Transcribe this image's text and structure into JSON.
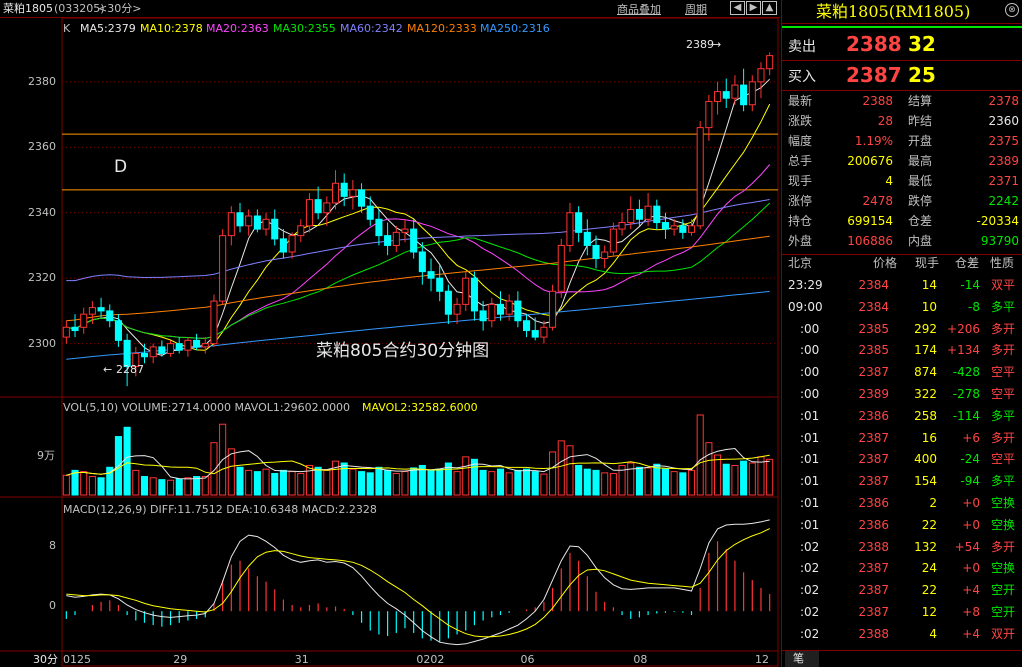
{
  "header": {
    "symbol": "菜粕1805",
    "code": "(033205)",
    "period": "<30分>",
    "overlay_btn": "商品叠加",
    "cycle_btn": "周期"
  },
  "ma_legend": {
    "k": "K",
    "items": [
      {
        "label": "MA5:2379",
        "color": "#e8e8e8"
      },
      {
        "label": "MA10:2378",
        "color": "#ffff00"
      },
      {
        "label": "MA20:2363",
        "color": "#ff44ff"
      },
      {
        "label": "MA30:2355",
        "color": "#00e600"
      },
      {
        "label": "MA60:2342",
        "color": "#8080ff"
      },
      {
        "label": "MA120:2333",
        "color": "#ff8000"
      },
      {
        "label": "MA250:2316",
        "color": "#3399ff"
      }
    ]
  },
  "price_axis": {
    "labels": [
      "2380",
      "2360",
      "2340",
      "2320",
      "2300"
    ],
    "values": [
      2380,
      2360,
      2340,
      2320,
      2300
    ]
  },
  "annotations": {
    "d_label": "D",
    "high_mark": "2389",
    "low_mark": "2287",
    "caption": "菜粕805合约30分钟图"
  },
  "volume": {
    "legend": "VOL(5,10) VOLUME:2714.0000 MAVOL1:29602.0000",
    "mavol2": "MAVOL2:32582.6000",
    "axis_label": "9万"
  },
  "macd": {
    "legend": "MACD(12,26,9) DIFF:11.7512 DEA:10.6348 MACD:2.2328",
    "axis_labels": [
      "8",
      "0"
    ]
  },
  "time_axis": {
    "period": "30分",
    "labels": [
      "0125",
      "29",
      "31",
      "0202",
      "06",
      "08",
      "12"
    ]
  },
  "quote": {
    "title": "菜粕1805(RM1805)",
    "sell_label": "卖出",
    "sell_price": "2388",
    "sell_vol": "32",
    "buy_label": "买入",
    "buy_price": "2387",
    "buy_vol": "25",
    "stats": [
      {
        "l1": "最新",
        "v1": "2388",
        "c1": "red",
        "l2": "结算",
        "v2": "2378",
        "c2": "red"
      },
      {
        "l1": "涨跌",
        "v1": "28",
        "c1": "red",
        "l2": "昨结",
        "v2": "2360",
        "c2": "wht"
      },
      {
        "l1": "幅度",
        "v1": "1.19%",
        "c1": "red",
        "l2": "开盘",
        "v2": "2375",
        "c2": "red"
      },
      {
        "l1": "总手",
        "v1": "200676",
        "c1": "yel",
        "l2": "最高",
        "v2": "2389",
        "c2": "red"
      },
      {
        "l1": "现手",
        "v1": "4",
        "c1": "yel",
        "l2": "最低",
        "v2": "2371",
        "c2": "red"
      },
      {
        "l1": "涨停",
        "v1": "2478",
        "c1": "red",
        "l2": "跌停",
        "v2": "2242",
        "c2": "grn"
      },
      {
        "l1": "持仓",
        "v1": "699154",
        "c1": "yel",
        "l2": "仓差",
        "v2": "-20334",
        "c2": "yel"
      },
      {
        "l1": "外盘",
        "v1": "106886",
        "c1": "red",
        "l2": "内盘",
        "v2": "93790",
        "c2": "grn"
      }
    ],
    "ticks_header": [
      "北京",
      "价格",
      "现手",
      "仓差",
      "性质"
    ],
    "ticks": [
      {
        "time": "23:29",
        "price": "2384",
        "vol": "14",
        "diff": "-14",
        "type": "双平",
        "tc": "red"
      },
      {
        "time": "09:00",
        "price": "2384",
        "vol": "10",
        "diff": "-8",
        "type": "多平",
        "tc": "grn"
      },
      {
        "time": ":00",
        "price": "2385",
        "vol": "292",
        "diff": "+206",
        "type": "多开",
        "tc": "red"
      },
      {
        "time": ":00",
        "price": "2385",
        "vol": "174",
        "diff": "+134",
        "type": "多开",
        "tc": "red"
      },
      {
        "time": ":00",
        "price": "2387",
        "vol": "874",
        "diff": "-428",
        "type": "空平",
        "tc": "red"
      },
      {
        "time": ":00",
        "price": "2389",
        "vol": "322",
        "diff": "-278",
        "type": "空平",
        "tc": "red"
      },
      {
        "time": ":01",
        "price": "2386",
        "vol": "258",
        "diff": "-114",
        "type": "多平",
        "tc": "grn"
      },
      {
        "time": ":01",
        "price": "2387",
        "vol": "16",
        "diff": "+6",
        "type": "多开",
        "tc": "red"
      },
      {
        "time": ":01",
        "price": "2387",
        "vol": "400",
        "diff": "-24",
        "type": "空平",
        "tc": "red"
      },
      {
        "time": ":01",
        "price": "2387",
        "vol": "154",
        "diff": "-94",
        "type": "多平",
        "tc": "grn"
      },
      {
        "time": ":01",
        "price": "2386",
        "vol": "2",
        "diff": "+0",
        "type": "空换",
        "tc": "grn"
      },
      {
        "time": ":01",
        "price": "2386",
        "vol": "22",
        "diff": "+0",
        "type": "空换",
        "tc": "grn"
      },
      {
        "time": ":02",
        "price": "2388",
        "vol": "132",
        "diff": "+54",
        "type": "多开",
        "tc": "red"
      },
      {
        "time": ":02",
        "price": "2387",
        "vol": "24",
        "diff": "+0",
        "type": "空换",
        "tc": "grn"
      },
      {
        "time": ":02",
        "price": "2387",
        "vol": "22",
        "diff": "+4",
        "type": "空开",
        "tc": "grn"
      },
      {
        "time": ":02",
        "price": "2387",
        "vol": "12",
        "diff": "+8",
        "type": "空开",
        "tc": "grn"
      },
      {
        "time": ":02",
        "price": "2388",
        "vol": "4",
        "diff": "+4",
        "type": "双开",
        "tc": "red"
      }
    ],
    "bottom_tab": "笔"
  },
  "chart_data": {
    "type": "candlestick",
    "title": "菜粕805合约30分钟图",
    "ylim": [
      2284,
      2394
    ],
    "x_labels": [
      "0125",
      "29",
      "31",
      "0202",
      "06",
      "08",
      "12"
    ],
    "candles": [
      {
        "o": 2302,
        "h": 2307,
        "l": 2300,
        "c": 2305
      },
      {
        "o": 2305,
        "h": 2309,
        "l": 2302,
        "c": 2304
      },
      {
        "o": 2305,
        "h": 2311,
        "l": 2303,
        "c": 2309
      },
      {
        "o": 2309,
        "h": 2313,
        "l": 2306,
        "c": 2311
      },
      {
        "o": 2311,
        "h": 2314,
        "l": 2308,
        "c": 2310
      },
      {
        "o": 2310,
        "h": 2312,
        "l": 2305,
        "c": 2307
      },
      {
        "o": 2307,
        "h": 2309,
        "l": 2299,
        "c": 2301
      },
      {
        "o": 2301,
        "h": 2303,
        "l": 2287,
        "c": 2293
      },
      {
        "o": 2293,
        "h": 2299,
        "l": 2290,
        "c": 2297
      },
      {
        "o": 2297,
        "h": 2300,
        "l": 2294,
        "c": 2296
      },
      {
        "o": 2296,
        "h": 2300,
        "l": 2294,
        "c": 2299
      },
      {
        "o": 2299,
        "h": 2301,
        "l": 2296,
        "c": 2297
      },
      {
        "o": 2297,
        "h": 2301,
        "l": 2296,
        "c": 2300
      },
      {
        "o": 2300,
        "h": 2302,
        "l": 2297,
        "c": 2298
      },
      {
        "o": 2298,
        "h": 2302,
        "l": 2296,
        "c": 2301
      },
      {
        "o": 2301,
        "h": 2303,
        "l": 2298,
        "c": 2299
      },
      {
        "o": 2299,
        "h": 2302,
        "l": 2297,
        "c": 2300
      },
      {
        "o": 2300,
        "h": 2315,
        "l": 2299,
        "c": 2313
      },
      {
        "o": 2313,
        "h": 2335,
        "l": 2312,
        "c": 2333
      },
      {
        "o": 2333,
        "h": 2342,
        "l": 2330,
        "c": 2340
      },
      {
        "o": 2340,
        "h": 2343,
        "l": 2334,
        "c": 2336
      },
      {
        "o": 2336,
        "h": 2341,
        "l": 2333,
        "c": 2339
      },
      {
        "o": 2339,
        "h": 2341,
        "l": 2334,
        "c": 2335
      },
      {
        "o": 2335,
        "h": 2340,
        "l": 2333,
        "c": 2338
      },
      {
        "o": 2338,
        "h": 2341,
        "l": 2330,
        "c": 2332
      },
      {
        "o": 2332,
        "h": 2335,
        "l": 2326,
        "c": 2328
      },
      {
        "o": 2328,
        "h": 2334,
        "l": 2326,
        "c": 2333
      },
      {
        "o": 2333,
        "h": 2338,
        "l": 2331,
        "c": 2336
      },
      {
        "o": 2336,
        "h": 2346,
        "l": 2334,
        "c": 2344
      },
      {
        "o": 2344,
        "h": 2348,
        "l": 2338,
        "c": 2340
      },
      {
        "o": 2340,
        "h": 2345,
        "l": 2336,
        "c": 2343
      },
      {
        "o": 2343,
        "h": 2353,
        "l": 2341,
        "c": 2349
      },
      {
        "o": 2349,
        "h": 2352,
        "l": 2342,
        "c": 2345
      },
      {
        "o": 2345,
        "h": 2350,
        "l": 2341,
        "c": 2347
      },
      {
        "o": 2347,
        "h": 2349,
        "l": 2340,
        "c": 2342
      },
      {
        "o": 2342,
        "h": 2345,
        "l": 2336,
        "c": 2338
      },
      {
        "o": 2338,
        "h": 2341,
        "l": 2330,
        "c": 2333
      },
      {
        "o": 2333,
        "h": 2337,
        "l": 2327,
        "c": 2330
      },
      {
        "o": 2330,
        "h": 2336,
        "l": 2328,
        "c": 2334
      },
      {
        "o": 2334,
        "h": 2338,
        "l": 2331,
        "c": 2335
      },
      {
        "o": 2335,
        "h": 2338,
        "l": 2326,
        "c": 2328
      },
      {
        "o": 2328,
        "h": 2331,
        "l": 2318,
        "c": 2322
      },
      {
        "o": 2322,
        "h": 2326,
        "l": 2316,
        "c": 2320
      },
      {
        "o": 2320,
        "h": 2324,
        "l": 2313,
        "c": 2316
      },
      {
        "o": 2316,
        "h": 2318,
        "l": 2306,
        "c": 2309
      },
      {
        "o": 2309,
        "h": 2314,
        "l": 2306,
        "c": 2312
      },
      {
        "o": 2312,
        "h": 2322,
        "l": 2310,
        "c": 2320
      },
      {
        "o": 2320,
        "h": 2322,
        "l": 2307,
        "c": 2310
      },
      {
        "o": 2310,
        "h": 2313,
        "l": 2304,
        "c": 2307
      },
      {
        "o": 2307,
        "h": 2314,
        "l": 2305,
        "c": 2312
      },
      {
        "o": 2312,
        "h": 2316,
        "l": 2307,
        "c": 2309
      },
      {
        "o": 2309,
        "h": 2315,
        "l": 2307,
        "c": 2313
      },
      {
        "o": 2313,
        "h": 2316,
        "l": 2305,
        "c": 2307
      },
      {
        "o": 2307,
        "h": 2309,
        "l": 2302,
        "c": 2304
      },
      {
        "o": 2304,
        "h": 2308,
        "l": 2301,
        "c": 2302
      },
      {
        "o": 2302,
        "h": 2307,
        "l": 2300,
        "c": 2305
      },
      {
        "o": 2305,
        "h": 2318,
        "l": 2304,
        "c": 2316
      },
      {
        "o": 2316,
        "h": 2332,
        "l": 2314,
        "c": 2330
      },
      {
        "o": 2330,
        "h": 2343,
        "l": 2328,
        "c": 2340
      },
      {
        "o": 2340,
        "h": 2342,
        "l": 2331,
        "c": 2334
      },
      {
        "o": 2334,
        "h": 2338,
        "l": 2327,
        "c": 2330
      },
      {
        "o": 2330,
        "h": 2333,
        "l": 2323,
        "c": 2326
      },
      {
        "o": 2326,
        "h": 2330,
        "l": 2323,
        "c": 2328
      },
      {
        "o": 2328,
        "h": 2337,
        "l": 2327,
        "c": 2335
      },
      {
        "o": 2335,
        "h": 2340,
        "l": 2333,
        "c": 2337
      },
      {
        "o": 2337,
        "h": 2345,
        "l": 2335,
        "c": 2341
      },
      {
        "o": 2341,
        "h": 2344,
        "l": 2336,
        "c": 2338
      },
      {
        "o": 2338,
        "h": 2346,
        "l": 2336,
        "c": 2342
      },
      {
        "o": 2342,
        "h": 2344,
        "l": 2335,
        "c": 2337
      },
      {
        "o": 2337,
        "h": 2340,
        "l": 2332,
        "c": 2335
      },
      {
        "o": 2335,
        "h": 2338,
        "l": 2333,
        "c": 2336
      },
      {
        "o": 2336,
        "h": 2338,
        "l": 2332,
        "c": 2334
      },
      {
        "o": 2334,
        "h": 2338,
        "l": 2333,
        "c": 2336
      },
      {
        "o": 2336,
        "h": 2368,
        "l": 2335,
        "c": 2366
      },
      {
        "o": 2366,
        "h": 2376,
        "l": 2362,
        "c": 2374
      },
      {
        "o": 2374,
        "h": 2380,
        "l": 2370,
        "c": 2377
      },
      {
        "o": 2377,
        "h": 2381,
        "l": 2372,
        "c": 2375
      },
      {
        "o": 2375,
        "h": 2382,
        "l": 2373,
        "c": 2379
      },
      {
        "o": 2379,
        "h": 2384,
        "l": 2371,
        "c": 2373
      },
      {
        "o": 2373,
        "h": 2382,
        "l": 2371,
        "c": 2380
      },
      {
        "o": 2380,
        "h": 2386,
        "l": 2375,
        "c": 2384
      },
      {
        "o": 2384,
        "h": 2389,
        "l": 2382,
        "c": 2388
      }
    ],
    "volume_scale_max": 130000,
    "volumes": [
      32,
      40,
      38,
      30,
      28,
      45,
      95,
      110,
      40,
      30,
      28,
      25,
      24,
      26,
      28,
      30,
      30,
      85,
      115,
      75,
      45,
      40,
      38,
      42,
      35,
      40,
      38,
      35,
      48,
      45,
      40,
      55,
      52,
      42,
      38,
      36,
      45,
      40,
      35,
      38,
      44,
      48,
      40,
      42,
      52,
      38,
      62,
      58,
      40,
      38,
      42,
      36,
      40,
      42,
      38,
      34,
      70,
      88,
      80,
      48,
      42,
      40,
      36,
      35,
      48,
      52,
      45,
      44,
      50,
      42,
      38,
      36,
      40,
      130,
      85,
      65,
      50,
      48,
      55,
      52,
      62,
      58
    ],
    "macd_range": [
      -5,
      12
    ],
    "macd_hist": [
      -1,
      -0.5,
      0,
      0.8,
      1.2,
      1.4,
      0.8,
      -0.5,
      -1.2,
      -1.5,
      -1.8,
      -2,
      -1.8,
      -1.5,
      -1.2,
      -1,
      -0.8,
      1,
      4,
      6,
      6.5,
      5.5,
      4.5,
      3.8,
      2.8,
      1.5,
      0.8,
      0.5,
      0.8,
      1,
      0.5,
      0.6,
      0.3,
      -0.5,
      -1.5,
      -2.5,
      -3,
      -3.2,
      -2.8,
      -2.2,
      -2.8,
      -3.5,
      -3.8,
      -4,
      -3.5,
      -3,
      -2.5,
      -1.8,
      -1.2,
      -0.8,
      -0.5,
      -0.2,
      0,
      0.2,
      0.5,
      1.2,
      3,
      5.5,
      7.5,
      6.5,
      4.5,
      2.5,
      1.2,
      0.5,
      -0.5,
      -1,
      -0.8,
      -0.5,
      -0.3,
      -0.2,
      -0.1,
      -0.2,
      -0.5,
      3,
      7.5,
      9,
      8,
      6.5,
      5,
      4,
      3,
      2.2
    ],
    "diff": [
      2,
      1.8,
      1.9,
      2.1,
      2.2,
      2.1,
      1.6,
      0.8,
      0.2,
      -0.2,
      -0.5,
      -0.7,
      -0.8,
      -0.7,
      -0.6,
      -0.5,
      -0.3,
      1,
      3.8,
      7,
      9,
      9.8,
      9.6,
      9,
      8.2,
      7.2,
      6.6,
      6.3,
      6.5,
      6.6,
      6.3,
      6.4,
      6.2,
      5.6,
      4.5,
      3.2,
      2,
      1,
      0.3,
      -0.5,
      -1.5,
      -2.5,
      -3.3,
      -4,
      -4.2,
      -4.3,
      -4.2,
      -3.9,
      -3.6,
      -3.2,
      -2.8,
      -2.3,
      -1.8,
      -1,
      0,
      1.5,
      4,
      6.5,
      8.4,
      8.3,
      7.2,
      5.6,
      4.3,
      3.4,
      2.9,
      2.8,
      2.9,
      3,
      3,
      3,
      3,
      2.8,
      2.6,
      5.5,
      8.8,
      10.6,
      11.1,
      11.2,
      11.2,
      11.3,
      11.5,
      11.75
    ],
    "dea": [
      2.2,
      2.1,
      2,
      2,
      2.1,
      2.1,
      2,
      1.7,
      1.4,
      1,
      0.7,
      0.5,
      0.3,
      0.2,
      0.1,
      0,
      -0.1,
      0.2,
      1,
      2.5,
      4.3,
      5.8,
      7,
      7.6,
      7.8,
      7.7,
      7.4,
      7.1,
      6.9,
      6.8,
      6.7,
      6.6,
      6.5,
      6.3,
      5.9,
      5.3,
      4.6,
      3.8,
      3.1,
      2.4,
      1.5,
      0.7,
      -0.2,
      -1,
      -1.8,
      -2.4,
      -2.9,
      -3.2,
      -3.3,
      -3.3,
      -3.2,
      -3,
      -2.7,
      -2.3,
      -1.7,
      -0.8,
      0.4,
      1.9,
      3.4,
      4.6,
      5.3,
      5.4,
      5.2,
      4.8,
      4.4,
      4,
      3.8,
      3.6,
      3.5,
      3.4,
      3.3,
      3.2,
      3.1,
      3.6,
      5,
      6.6,
      7.8,
      8.6,
      9.2,
      9.7,
      10.1,
      10.63
    ]
  }
}
